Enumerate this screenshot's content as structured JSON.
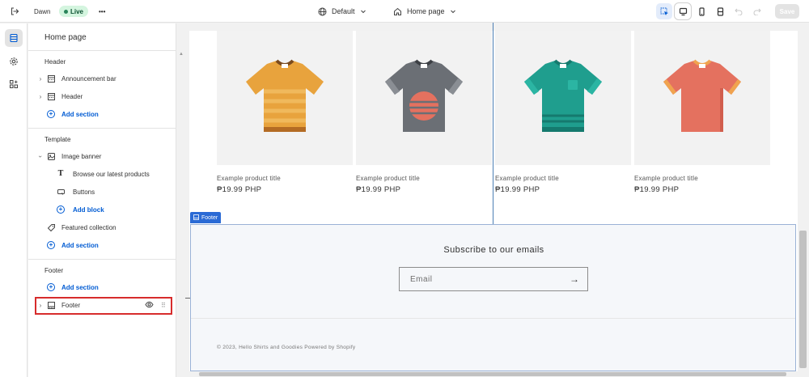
{
  "topbar": {
    "theme_name": "Dawn",
    "live_label": "Live",
    "more_label": "•••",
    "template_label": "Default",
    "page_label": "Home page",
    "save_label": "Save"
  },
  "sidebar": {
    "title": "Home page",
    "header_group": "Header",
    "header_items": [
      {
        "label": "Announcement bar",
        "icon": "section-icon"
      },
      {
        "label": "Header",
        "icon": "section-icon"
      }
    ],
    "add_section": "Add section",
    "template_group": "Template",
    "image_banner": "Image banner",
    "banner_blocks": [
      {
        "label": "Browse our latest products",
        "icon": "text-icon"
      },
      {
        "label": "Buttons",
        "icon": "button-icon"
      }
    ],
    "add_block": "Add block",
    "featured_collection": "Featured collection",
    "footer_group": "Footer",
    "footer_item": "Footer"
  },
  "products": [
    {
      "title": "Example product title",
      "price": "₱19.99 PHP",
      "color": "#e8a33d"
    },
    {
      "title": "Example product title",
      "price": "₱19.99 PHP",
      "color": "#6b6f75"
    },
    {
      "title": "Example product title",
      "price": "₱19.99 PHP",
      "color": "#1f9e8e"
    },
    {
      "title": "Example product title",
      "price": "₱19.99 PHP",
      "color": "#e4715f"
    }
  ],
  "footer": {
    "tag_label": "Footer",
    "subscribe_heading": "Subscribe to our emails",
    "email_placeholder": "Email",
    "copyright": "© 2023, Hello Shirts and Goodies Powered by Shopify"
  },
  "colors": {
    "accent": "#005bd3",
    "selection": "#2a6ad5",
    "highlight": "#d72c2c"
  }
}
